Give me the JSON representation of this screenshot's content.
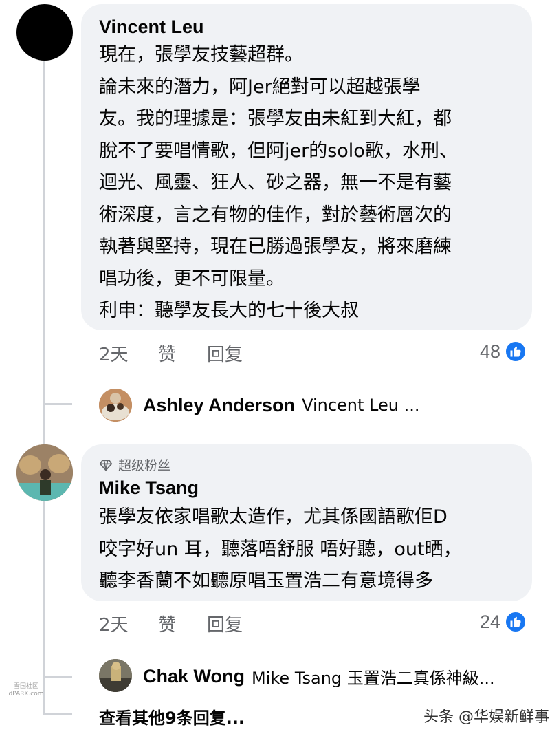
{
  "comments": [
    {
      "author": "Vincent Leu",
      "lines": [
        "現在，張學友技藝超群。",
        "論未來的潛力，阿Jer絕對可以超越張學",
        "友。我的理據是：張學友由未紅到大紅，都",
        "脫不了要唱情歌，但阿jer的solo歌，水刑、",
        "迴光、風靈、狂人、砂之器，無一不是有藝",
        "術深度，言之有物的佳作，對於藝術層次的",
        "執著與堅持，現在已勝過張學友，將來磨練",
        "唱功後，更不可限量。",
        "利申：聽學友長大的七十後大叔"
      ],
      "time": "2天",
      "like_label": "赞",
      "reply_label": "回复",
      "reaction_count": "48",
      "reply": {
        "name": "Ashley Anderson",
        "text": "Vincent Leu ..."
      }
    },
    {
      "badge": "超级粉丝",
      "author": "Mike Tsang",
      "lines": [
        "張學友依家唱歌太造作，尤其係國語歌佢D",
        "咬字好un 耳，聽落唔舒服 唔好聽，out晒，",
        "聽李香蘭不如聽原唱玉置浩二有意境得多"
      ],
      "time": "2天",
      "like_label": "赞",
      "reply_label": "回复",
      "reaction_count": "24",
      "reply": {
        "name": "Chak Wong",
        "text": "Mike Tsang 玉置浩二真係神級..."
      }
    }
  ],
  "more_replies": "查看其他9条回复...",
  "watermark": "头条 @华娱新鲜事",
  "watermark_small": {
    "line1": "雪国社区",
    "line2": "dPARK.com"
  },
  "colors": {
    "bubble": "#f0f2f5",
    "meta_text": "#65676b",
    "like_blue": "#1877f2",
    "thread_line": "#d0d3d8"
  },
  "icons": {
    "like": "thumbs-up-icon",
    "badge": "diamond-icon"
  }
}
